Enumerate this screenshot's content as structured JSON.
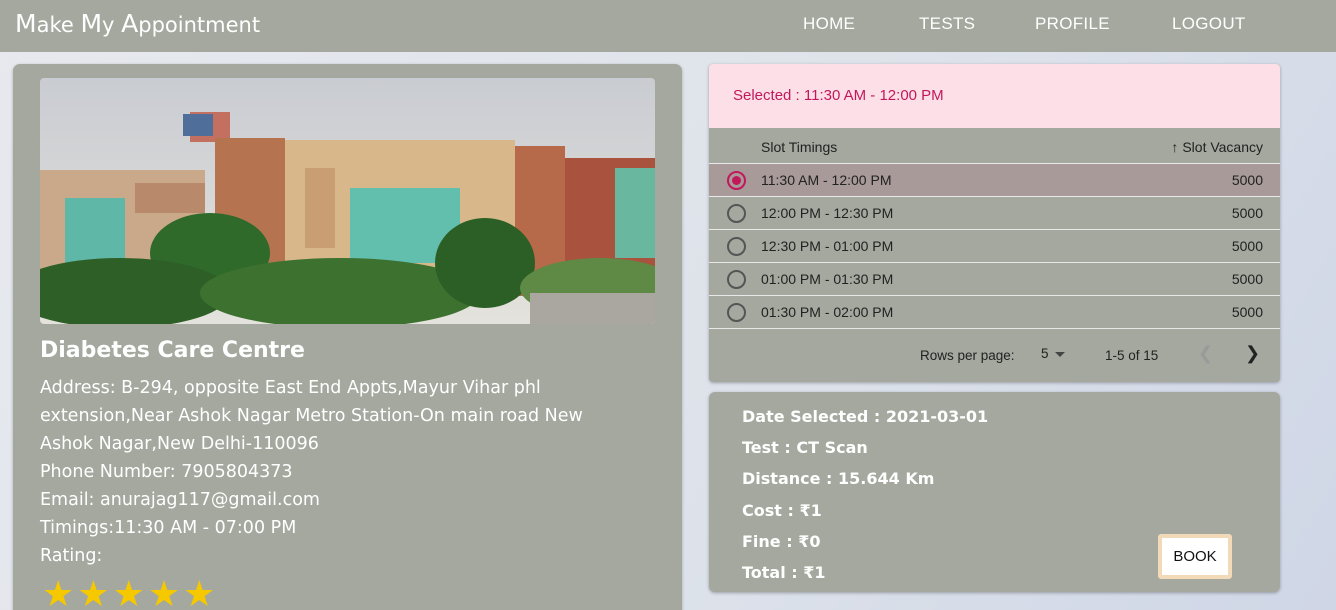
{
  "brand": {
    "c1": "M",
    "r1": "ake ",
    "c2": "M",
    "r2": "y ",
    "c3": "A",
    "r3": "ppointment"
  },
  "nav": {
    "home": "HOME",
    "tests": "TESTS",
    "profile": "PROFILE",
    "logout": "LOGOUT"
  },
  "centre": {
    "name": "Diabetes Care Centre",
    "address": "Address: B-294, opposite East End Appts,Mayur Vihar phl extension,Near Ashok Nagar Metro Station-On main road New Ashok Nagar,New Delhi-110096",
    "phone": "Phone Number: 7905804373",
    "email": "Email: anurajag117@gmail.com",
    "timings": "Timings:11:30 AM - 07:00 PM",
    "rating_label": "Rating:",
    "rating": 5
  },
  "slots": {
    "selected_text": "Selected : 11:30 AM - 12:00 PM",
    "col_timings": "Slot Timings",
    "col_vacancy": "Slot Vacancy",
    "rows": [
      {
        "time": "11:30 AM - 12:00 PM",
        "vacancy": "5000",
        "selected": true
      },
      {
        "time": "12:00 PM - 12:30 PM",
        "vacancy": "5000",
        "selected": false
      },
      {
        "time": "12:30 PM - 01:00 PM",
        "vacancy": "5000",
        "selected": false
      },
      {
        "time": "01:00 PM - 01:30 PM",
        "vacancy": "5000",
        "selected": false
      },
      {
        "time": "01:30 PM - 02:00 PM",
        "vacancy": "5000",
        "selected": false
      }
    ],
    "rows_per_page_label": "Rows per page:",
    "rows_per_page": "5",
    "range": "1-5 of 15"
  },
  "summary": {
    "date": "Date Selected : 2021-03-01",
    "test": "Test : CT Scan",
    "distance": "Distance : 15.644 Km",
    "cost": "Cost : ₹1",
    "fine": "Fine : ₹0",
    "total": "Total : ₹1",
    "book": "BOOK"
  },
  "colors": {
    "panel": "#a4a89e",
    "accent": "#c2185b",
    "banner": "#fde0e7",
    "star": "#f6c800"
  },
  "icons": {
    "sort": "arrow-up-icon",
    "prev": "chevron-left-icon",
    "next": "chevron-right-icon",
    "star": "star-icon"
  }
}
